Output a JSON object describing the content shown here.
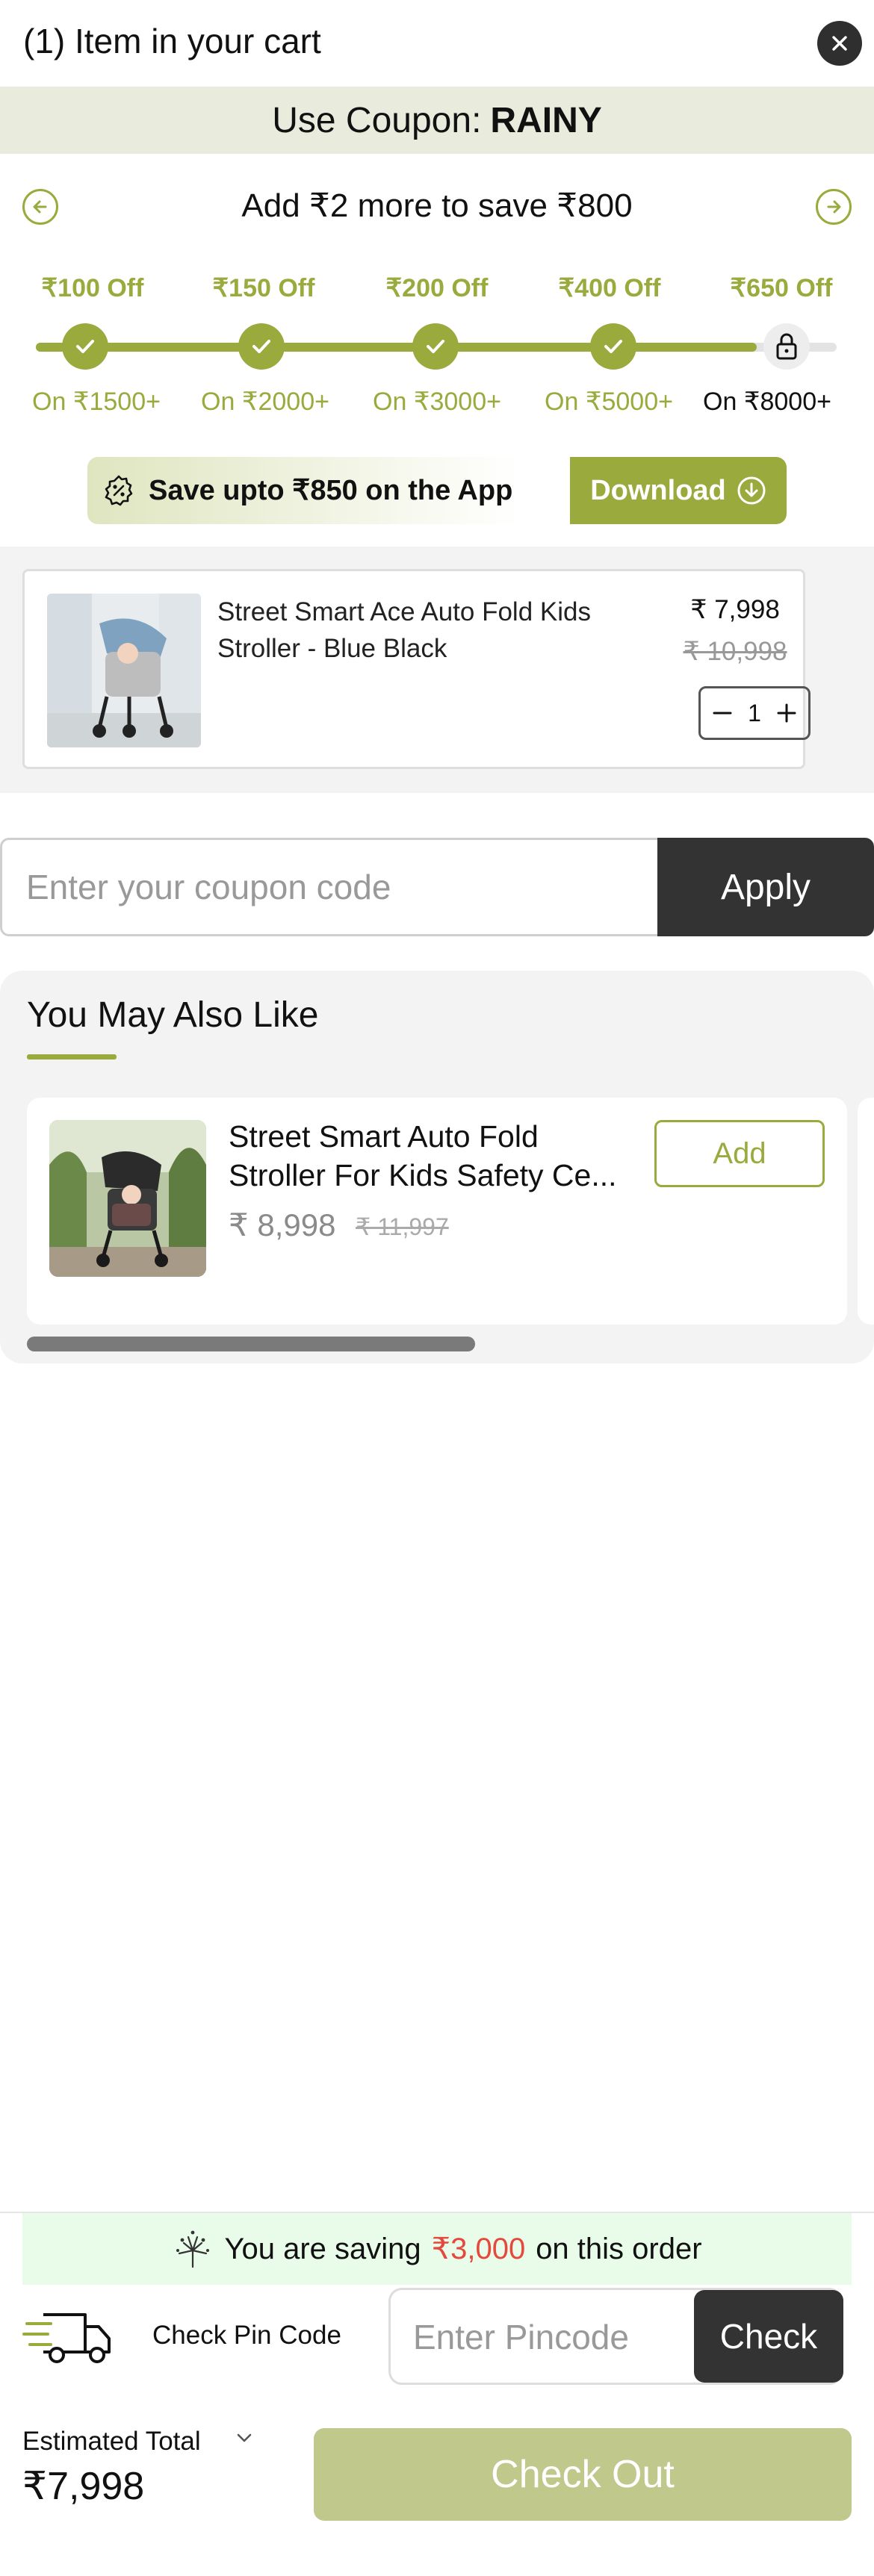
{
  "header": {
    "title": "(1) Item in your cart",
    "close_icon": "close-icon"
  },
  "coupon_banner": {
    "prefix": "Use Coupon:",
    "code": "RAINY"
  },
  "progress": {
    "message": "Add ₹2 more to save ₹800",
    "fill_fraction": 0.9,
    "tiers": [
      {
        "off": "₹100 Off",
        "on": "On ₹1500+",
        "state": "done"
      },
      {
        "off": "₹150 Off",
        "on": "On ₹2000+",
        "state": "done"
      },
      {
        "off": "₹200 Off",
        "on": "On ₹3000+",
        "state": "done"
      },
      {
        "off": "₹400 Off",
        "on": "On ₹5000+",
        "state": "done"
      },
      {
        "off": "₹650 Off",
        "on": "On ₹8000+",
        "state": "locked"
      }
    ]
  },
  "app_banner": {
    "text": "Save upto ₹850 on the App",
    "button": "Download"
  },
  "cart_item": {
    "name": "Street Smart Ace Auto Fold Kids Stroller - Blue Black",
    "price": "₹ 7,998",
    "mrp": "₹ 10,998",
    "quantity": "1"
  },
  "coupon_entry": {
    "placeholder": "Enter your coupon code",
    "apply": "Apply"
  },
  "recommendations": {
    "title": "You May Also Like",
    "items": [
      {
        "name": "Street Smart Auto Fold Stroller For Kids Safety Ce...",
        "price": "₹ 8,998",
        "mrp": "₹ 11,997",
        "button": "Add"
      }
    ]
  },
  "savings": {
    "prefix": "You are saving",
    "amount": "₹3,000",
    "suffix": "on this order"
  },
  "pincode": {
    "label": "Check Pin Code",
    "placeholder": "Enter Pincode",
    "button": "Check"
  },
  "footer": {
    "estimated_label": "Estimated Total",
    "total": "₹7,998",
    "checkout": "Check Out"
  },
  "colors": {
    "accent": "#9aaa3c",
    "dark": "#333333",
    "saving": "#e5483d",
    "checkout_disabled": "#c0c88b"
  }
}
